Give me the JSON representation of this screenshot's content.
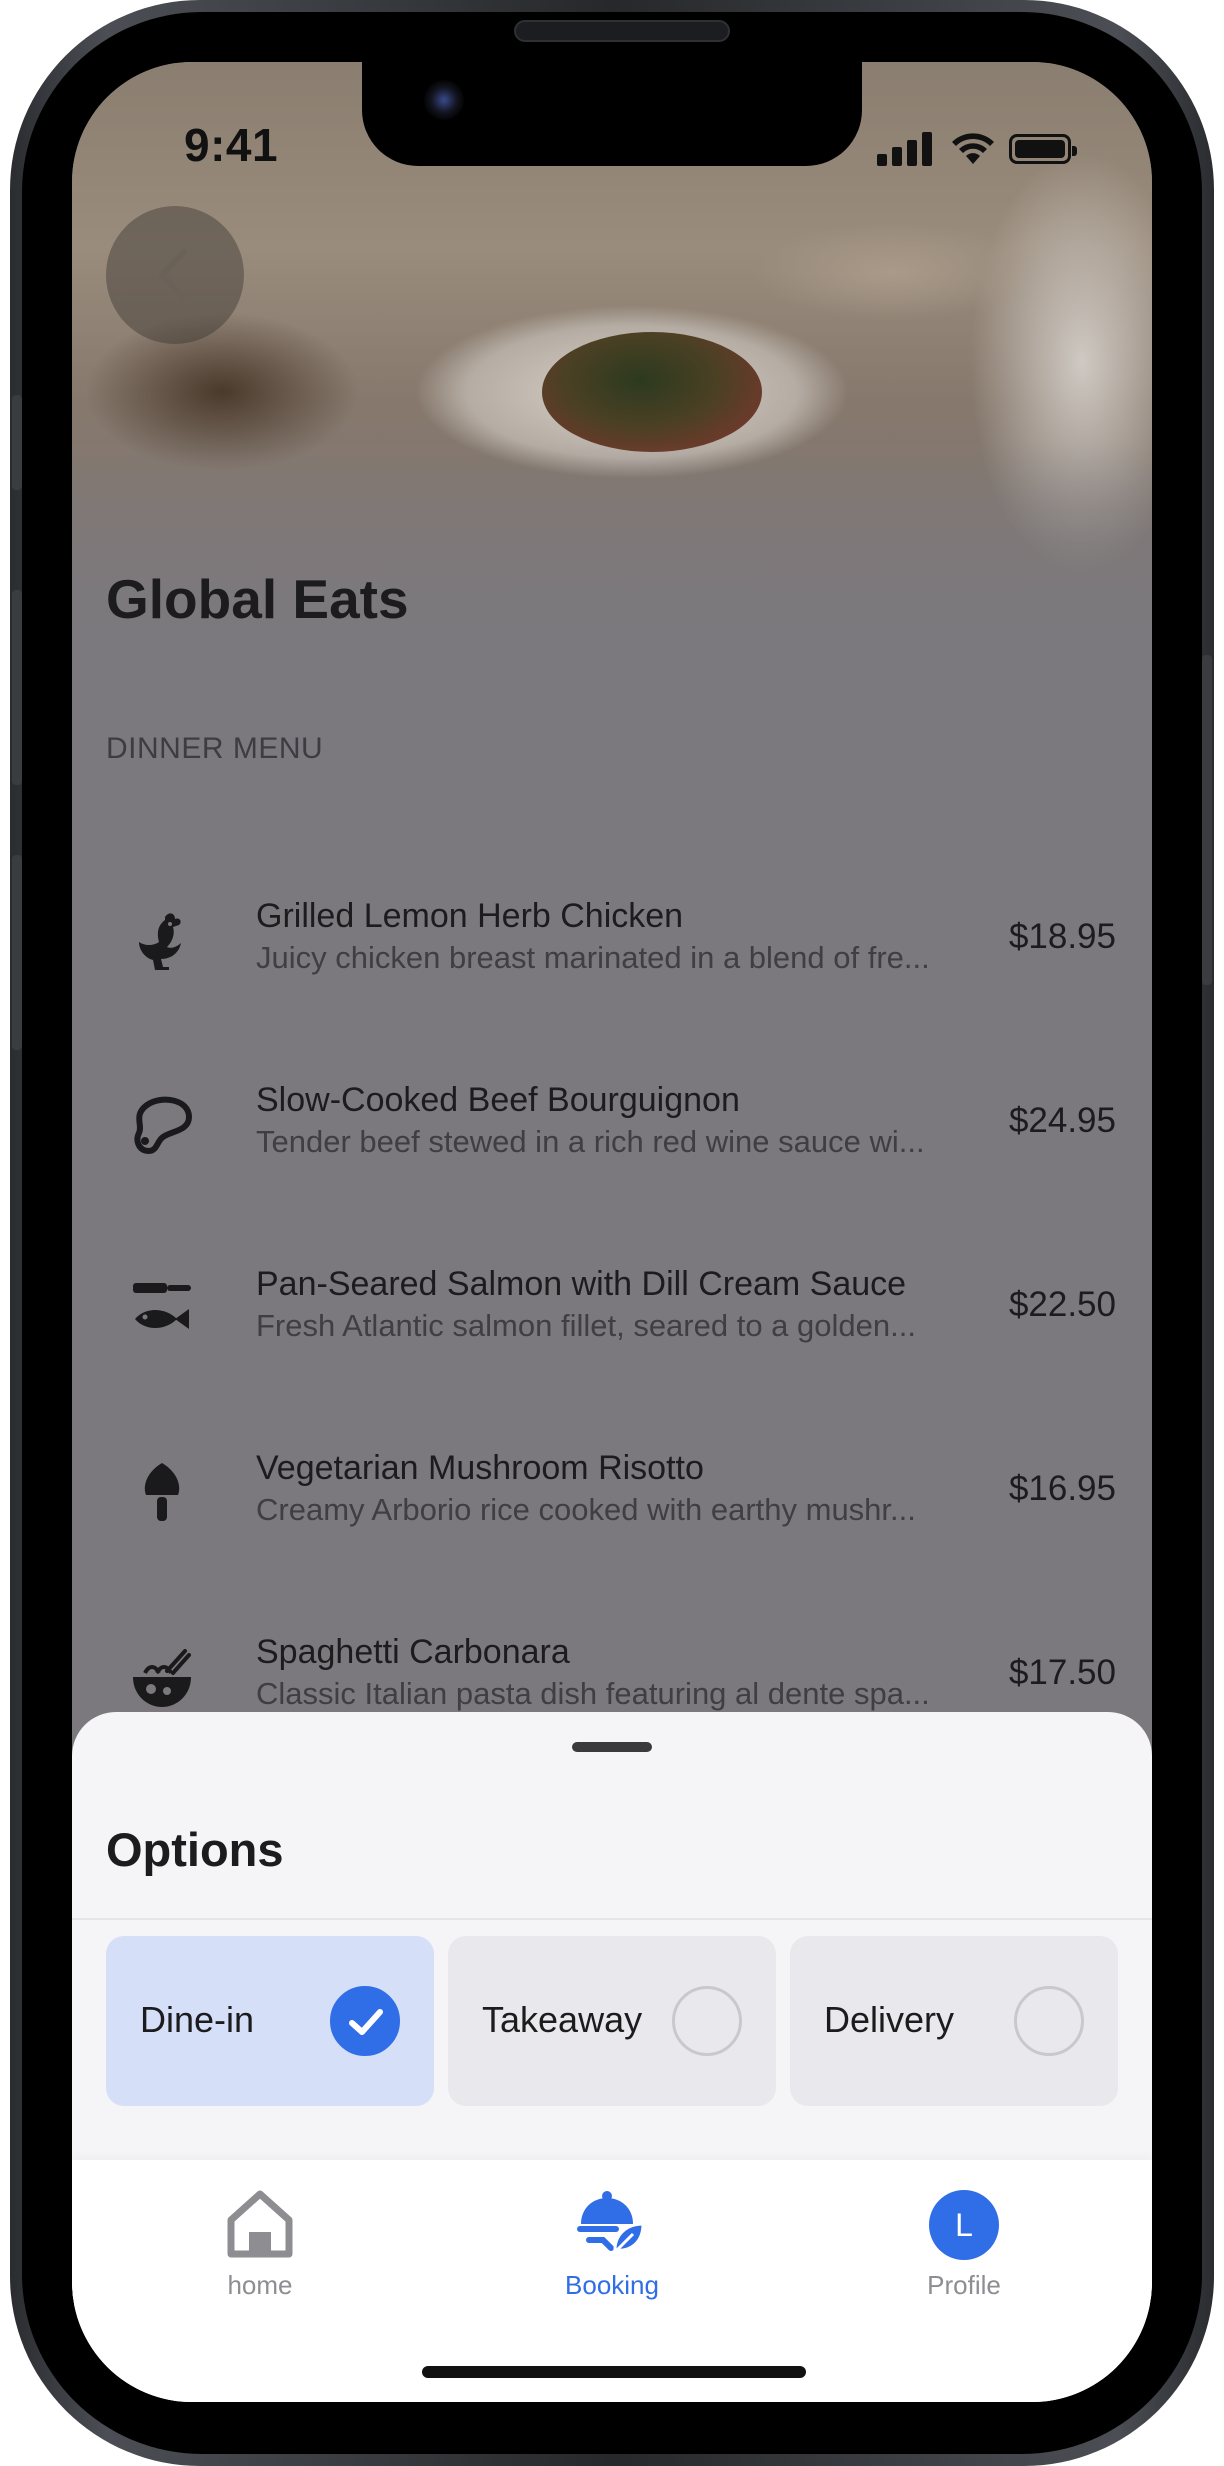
{
  "status_bar": {
    "time": "9:41"
  },
  "restaurant": {
    "name": "Global Eats"
  },
  "menu": {
    "section_title": "DINNER MENU",
    "items": [
      {
        "icon": "rooster-icon",
        "name": "Grilled Lemon Herb Chicken",
        "description": "Juicy chicken breast marinated in a blend of fre...",
        "price": "$18.95"
      },
      {
        "icon": "meat-cut-icon",
        "name": "Slow-Cooked Beef Bourguignon",
        "description": "Tender beef stewed in a rich red wine sauce wi...",
        "price": "$24.95"
      },
      {
        "icon": "fish-knife-icon",
        "name": "Pan-Seared Salmon with Dill Cream Sauce",
        "description": "Fresh Atlantic salmon fillet, seared to a golden...",
        "price": "$22.50"
      },
      {
        "icon": "mushroom-icon",
        "name": "Vegetarian Mushroom Risotto",
        "description": "Creamy Arborio rice cooked with earthy mushr...",
        "price": "$16.95"
      },
      {
        "icon": "noodle-bowl-icon",
        "name": "Spaghetti Carbonara",
        "description": "Classic Italian pasta dish featuring al dente spa...",
        "price": "$17.50"
      }
    ]
  },
  "options_sheet": {
    "title": "Options",
    "options": [
      {
        "label": "Dine-in",
        "selected": true
      },
      {
        "label": "Takeaway",
        "selected": false
      },
      {
        "label": "Delivery",
        "selected": false
      }
    ]
  },
  "tab_bar": {
    "tabs": [
      {
        "icon": "house-icon",
        "label": "home",
        "active": false
      },
      {
        "icon": "cloche-icon",
        "label": "Booking",
        "active": true
      },
      {
        "icon": "avatar",
        "label": "Profile",
        "active": false,
        "avatar_initial": "L"
      }
    ]
  },
  "colors": {
    "accent": "#2f6ee6",
    "selected_option_bg": "#d5dff7",
    "dim_overlay": "#7b797e"
  }
}
